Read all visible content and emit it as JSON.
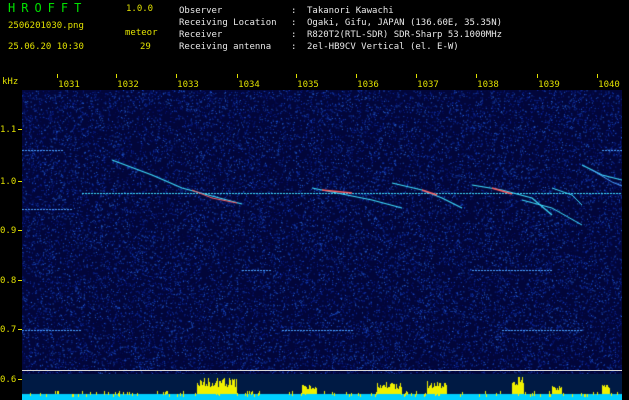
{
  "header": {
    "app_name": "HROFFT",
    "version": "1.0.0",
    "filename": "2506201030.png",
    "datetime": "25.06.20 10:30",
    "meteor_label": "meteor",
    "meteor_count": "29"
  },
  "info": {
    "rows": [
      {
        "key": "Observer",
        "value": "Takanori Kawachi"
      },
      {
        "key": "Receiving Location",
        "value": "Ogaki, Gifu, JAPAN (136.60E, 35.35N)"
      },
      {
        "key": "Receiver",
        "value": "R820T2(RTL-SDR) SDR-Sharp 53.1000MHz"
      },
      {
        "key": "Receiving antenna",
        "value": "2el-HB9CV Vertical (el. E-W)"
      }
    ]
  },
  "axes": {
    "y_unit": "kHz",
    "y_labels": [
      "1.1",
      "1.0",
      "0.9",
      "0.8",
      "0.7",
      "0.6"
    ],
    "x_labels": [
      "1031",
      "1032",
      "1033",
      "1034",
      "1035",
      "1036",
      "1037",
      "1038",
      "1039",
      "1040"
    ]
  },
  "colors": {
    "spectrogram_bg": "#02063a",
    "label": "#e0e000",
    "title": "#00e000",
    "trace": "#3fe0ff",
    "echo": "#ff6060",
    "activity": "#f0f000",
    "baseline": "#00d0ff"
  }
}
